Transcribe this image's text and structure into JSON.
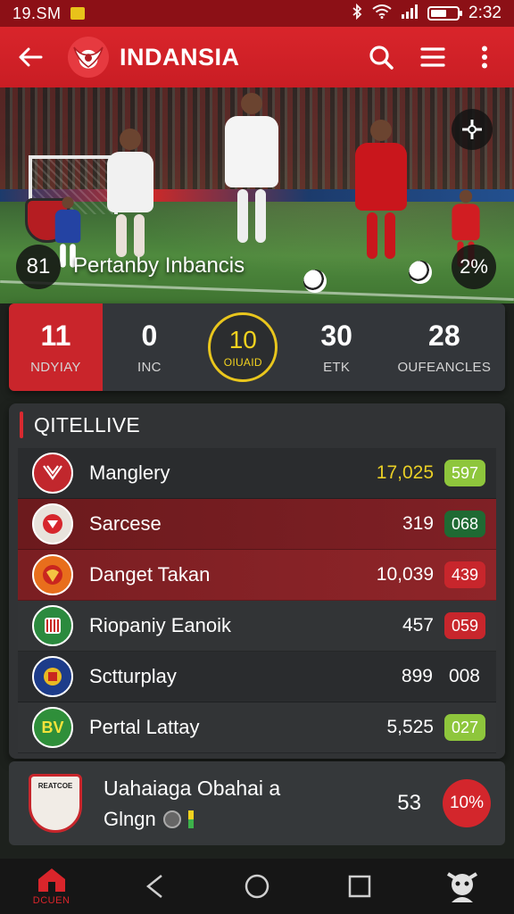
{
  "status_bar": {
    "time_left": "19.SM",
    "time_right": "2:32",
    "battery_level": 0.6
  },
  "app_bar": {
    "title": "INDANSIA",
    "icons": [
      "back-arrow-icon",
      "search-icon",
      "menu-icon",
      "more-vertical-icon"
    ]
  },
  "hero": {
    "left_round": "81",
    "caption": "Pertanby Inbancis",
    "right_round": "2%",
    "top_right_icon": "crosshair-icon"
  },
  "stats": [
    {
      "value": "11",
      "label": "NDYIAY"
    },
    {
      "value": "0",
      "label": "INC"
    },
    {
      "value": "10",
      "label": "OIUAID"
    },
    {
      "value": "30",
      "label": "ETK"
    },
    {
      "value": "28",
      "label": "OUFEANCLES"
    }
  ],
  "panel": {
    "title": "QITELLIVE",
    "rows": [
      {
        "name": "Manglery",
        "value": "17,025",
        "badge": "597"
      },
      {
        "name": "Sarcese",
        "value": "319",
        "badge": "068"
      },
      {
        "name": "Danget Takan",
        "value": "10,039",
        "badge": "439"
      },
      {
        "name": "Riopaniy Eanoik",
        "value": "457",
        "badge": "059"
      },
      {
        "name": "Sctturplay",
        "value": "899",
        "badge": "008"
      },
      {
        "name": "Pertal Lattay",
        "value": "5,525",
        "badge": "027"
      }
    ],
    "crest_initials": [
      "",
      "",
      "",
      "",
      "",
      "BV"
    ]
  },
  "bottom_card": {
    "crest_text": "REATCOE",
    "title": "Uahaiaga Obahai a",
    "subtitle": "Glngn",
    "value": "53",
    "badge": "10%"
  },
  "nav": {
    "home_label": "DCUEN",
    "icons": [
      "home-icon",
      "back-icon",
      "circle-home-icon",
      "square-recents-icon",
      "mascot-icon"
    ]
  },
  "colors": {
    "primary_red": "#d9252b",
    "gold": "#e9cf26",
    "lime": "#8ec63c",
    "dark_green": "#1f6a33"
  }
}
